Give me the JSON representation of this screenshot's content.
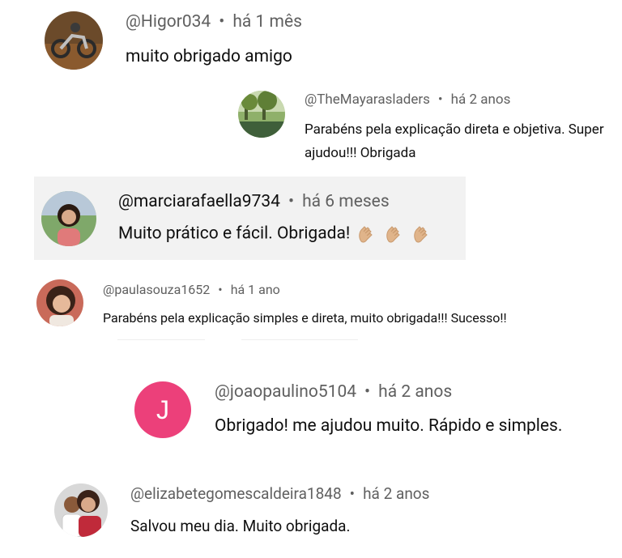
{
  "comments": [
    {
      "handle": "@Higor034",
      "time": "há 1 mês",
      "text": "muito obrigado amigo",
      "avatar": "motorcycle-photo-avatar"
    },
    {
      "handle": "@TheMayarasladers",
      "time": "há 2 anos",
      "text": "Parabéns pela explicação direta e objetiva. Super ajudou!!! Obrigada",
      "avatar": "landscape-photo-avatar"
    },
    {
      "handle": "@marciarafaella9734",
      "time": "há 6 meses",
      "text": "Muito prático e fácil. Obrigada!",
      "avatar": "woman-portrait-avatar",
      "emoji": "clapping-hands-icon"
    },
    {
      "handle": "@paulasouza1652",
      "time": "há 1 ano",
      "text": "Parabéns pela explicação simples e direta, muito obrigada!!! Sucesso!!",
      "avatar": "woman-selfie-avatar"
    },
    {
      "handle": "@joaopaulino5104",
      "time": "há 2 anos",
      "text": "Obrigado! me ajudou muito. Rápido e simples.",
      "avatar": "J",
      "avatar_color": "#ec407a"
    },
    {
      "handle": "@elizabetegomescaldeira1848",
      "time": "há 2 anos",
      "text": "Salvou meu dia. Muito obrigada.",
      "avatar": "couple-photo-avatar"
    }
  ],
  "separator": "•"
}
